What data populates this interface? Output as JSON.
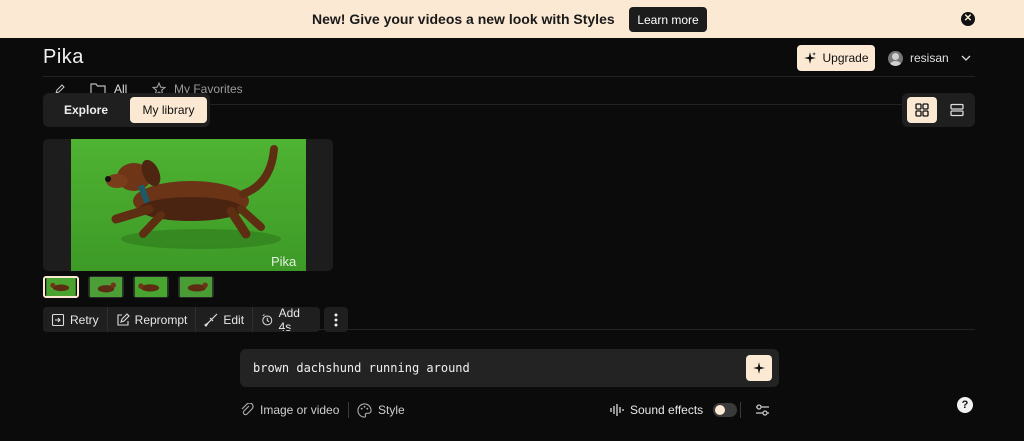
{
  "banner": {
    "message": "New! Give your videos a new look with Styles",
    "cta_label": "Learn more",
    "close_glyph": "✕"
  },
  "header": {
    "logo": "Pika",
    "upgrade_label": "Upgrade",
    "username": "resisan"
  },
  "filters": {
    "all_label": "All",
    "favorites_label": "My Favorites"
  },
  "library_toggle": {
    "explore_label": "Explore",
    "library_label": "My library",
    "selected": "My library"
  },
  "video": {
    "watermark": "Pika",
    "thumbnail_count": 4,
    "selected_thumbnail": 1
  },
  "actions": {
    "retry_label": "Retry",
    "reprompt_label": "Reprompt",
    "edit_label": "Edit",
    "add_label": "Add 4s"
  },
  "prompt": {
    "text": "brown dachshund running around"
  },
  "options": {
    "attach_label": "Image or video",
    "style_label": "Style",
    "sound_label": "Sound effects",
    "sound_enabled": false
  },
  "help_glyph": "?",
  "colors": {
    "accent": "#fbe9d3",
    "background": "#0b0b0b",
    "panel": "#1f1f1f"
  }
}
